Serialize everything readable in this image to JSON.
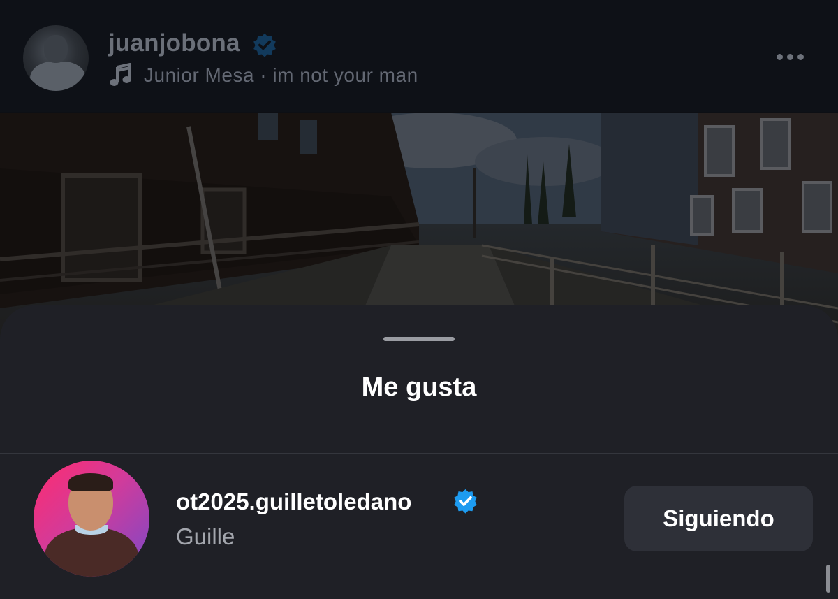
{
  "post": {
    "username": "juanjobona",
    "music": {
      "artist": "Junior Mesa",
      "separator": "·",
      "song": "im not your man"
    }
  },
  "likes_sheet": {
    "title": "Me gusta",
    "users": [
      {
        "handle": "ot2025.guilletoledano",
        "name": "Guille",
        "verified": true,
        "follow_label": "Siguiendo"
      }
    ]
  },
  "colors": {
    "verified": "#1d9bf0",
    "sheet_background": "#1f2026",
    "button_background": "#2e3038"
  },
  "icons": {
    "verified": "verified-badge-icon",
    "music": "music-note-icon",
    "more": "more-options-icon"
  }
}
